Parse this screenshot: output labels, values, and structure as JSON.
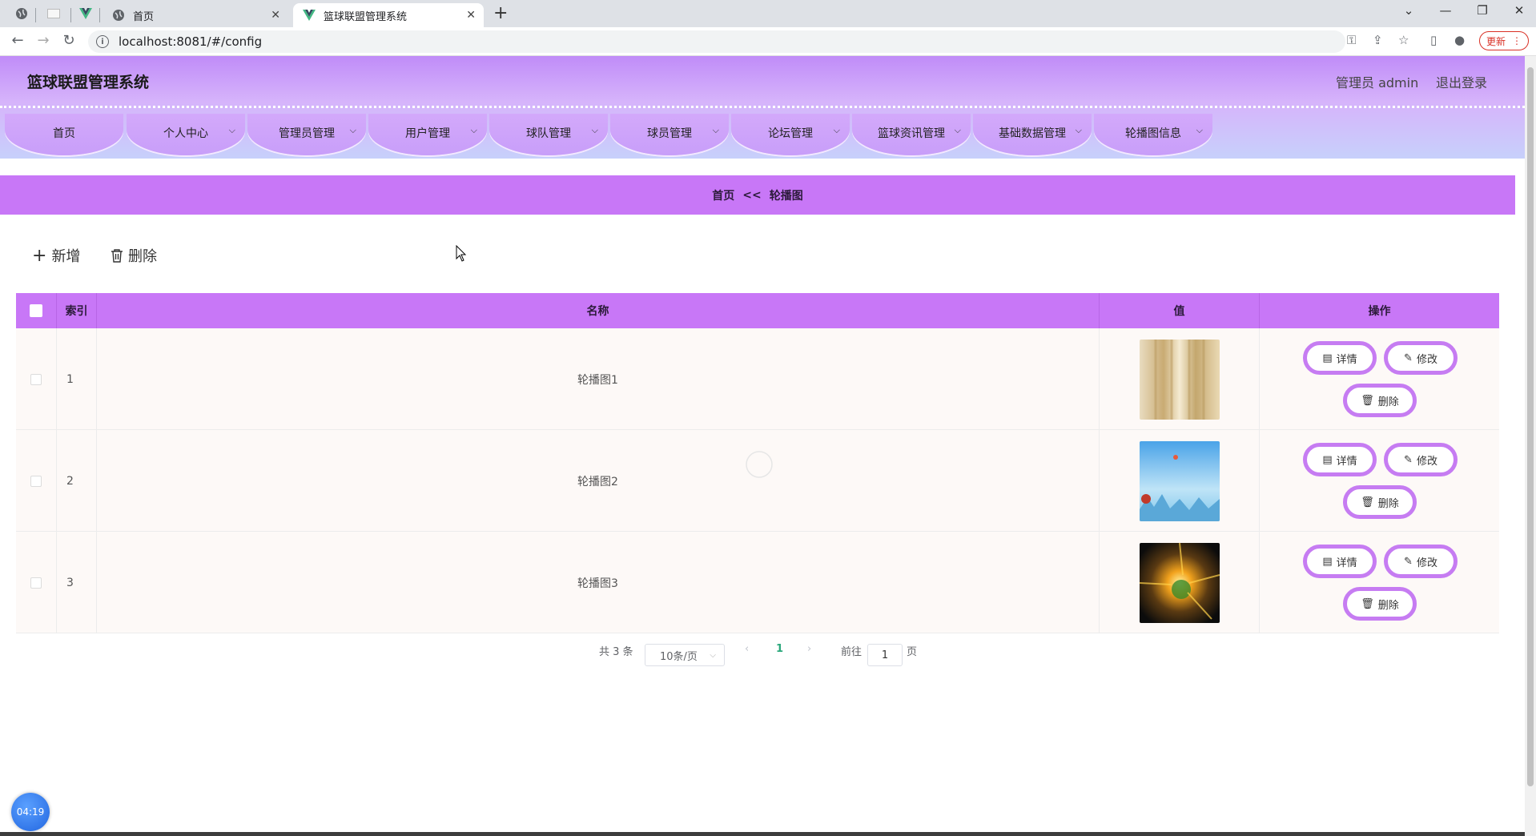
{
  "browser": {
    "tabs": [
      {
        "label": "首页"
      },
      {
        "label": "篮球联盟管理系统"
      }
    ],
    "url": "localhost:8081/#/config",
    "update_label": "更新"
  },
  "header": {
    "title": "篮球联盟管理系统",
    "user": "管理员 admin",
    "logout": "退出登录"
  },
  "nav": [
    {
      "label": "首页"
    },
    {
      "label": "个人中心"
    },
    {
      "label": "管理员管理"
    },
    {
      "label": "用户管理"
    },
    {
      "label": "球队管理"
    },
    {
      "label": "球员管理"
    },
    {
      "label": "论坛管理"
    },
    {
      "label": "篮球资讯管理"
    },
    {
      "label": "基础数据管理"
    },
    {
      "label": "轮播图信息"
    }
  ],
  "breadcrumb": {
    "home": "首页",
    "sep": "<<",
    "current": "轮播图"
  },
  "actions": {
    "add": "新增",
    "delete": "删除"
  },
  "table": {
    "columns": [
      "索引",
      "名称",
      "值",
      "操作"
    ],
    "rows": [
      {
        "index": "1",
        "name": "轮播图1"
      },
      {
        "index": "2",
        "name": "轮播图2"
      },
      {
        "index": "3",
        "name": "轮播图3"
      }
    ],
    "row_actions": {
      "detail": "详情",
      "edit": "修改",
      "delete": "删除"
    }
  },
  "pagination": {
    "total": "共 3 条",
    "page_size": "10条/页",
    "current_page": "1",
    "goto_prefix": "前往",
    "goto_value": "1",
    "goto_suffix": "页"
  },
  "clock": "04:19",
  "colors": {
    "accent": "#c877f7",
    "button_border": "#c67cf2"
  }
}
